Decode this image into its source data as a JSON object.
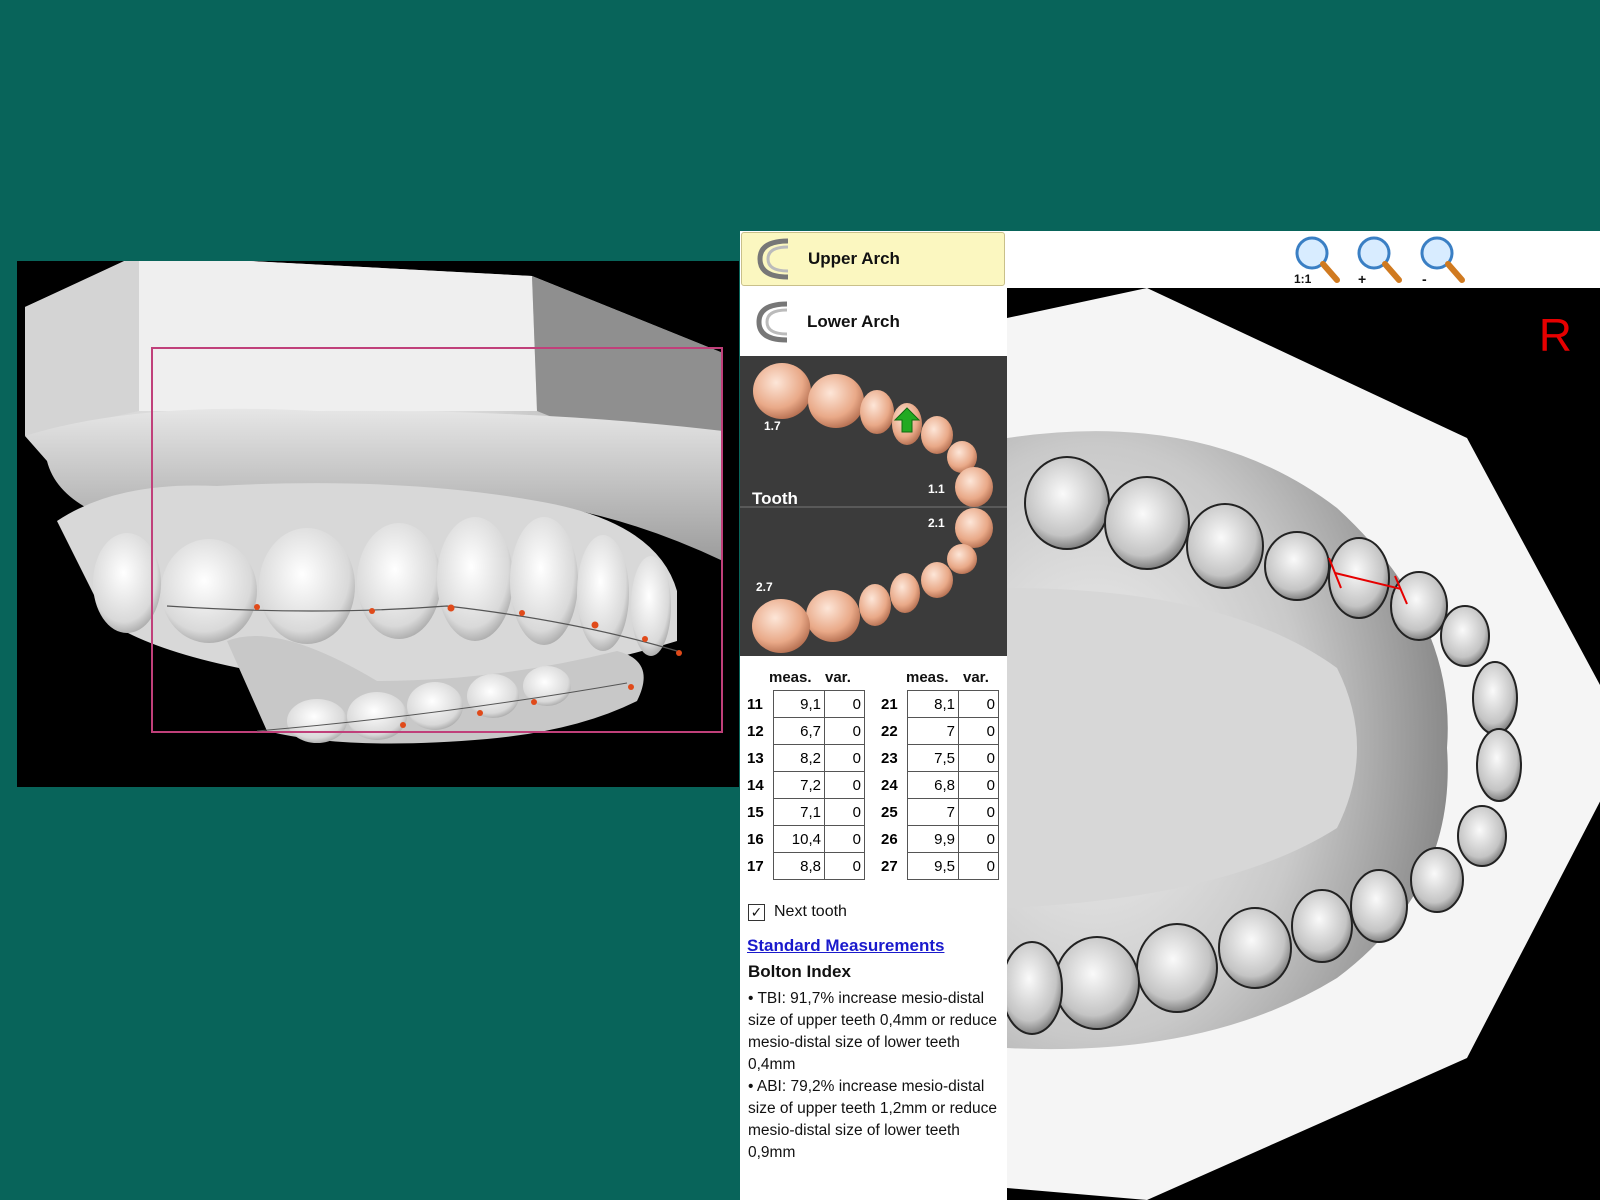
{
  "panel": {
    "upper_arch_label": "Upper Arch",
    "lower_arch_label": "Lower Arch",
    "selected_arch": "upper",
    "tooth_map": {
      "title": "Tooth",
      "labels": [
        "1.7",
        "1.1",
        "2.1",
        "2.7"
      ]
    },
    "table_headers": {
      "meas": "meas.",
      "var": "var."
    },
    "upper_quadrant": [
      {
        "tooth": "11",
        "meas": "9,1",
        "var": "0"
      },
      {
        "tooth": "12",
        "meas": "6,7",
        "var": "0"
      },
      {
        "tooth": "13",
        "meas": "8,2",
        "var": "0"
      },
      {
        "tooth": "14",
        "meas": "7,2",
        "var": "0"
      },
      {
        "tooth": "15",
        "meas": "7,1",
        "var": "0"
      },
      {
        "tooth": "16",
        "meas": "10,4",
        "var": "0"
      },
      {
        "tooth": "17",
        "meas": "8,8",
        "var": "0"
      }
    ],
    "left_quadrant": [
      {
        "tooth": "21",
        "meas": "8,1",
        "var": "0"
      },
      {
        "tooth": "22",
        "meas": "7",
        "var": "0"
      },
      {
        "tooth": "23",
        "meas": "7,5",
        "var": "0"
      },
      {
        "tooth": "24",
        "meas": "6,8",
        "var": "0"
      },
      {
        "tooth": "25",
        "meas": "7",
        "var": "0"
      },
      {
        "tooth": "26",
        "meas": "9,9",
        "var": "0"
      },
      {
        "tooth": "27",
        "meas": "9,5",
        "var": "0"
      }
    ],
    "next_tooth": {
      "label": "Next tooth",
      "checked": true
    },
    "standard_measurements_link": "Standard Measurements",
    "bolton": {
      "title": "Bolton Index",
      "tbi": "• TBI: 91,7% increase mesio-distal size of upper teeth 0,4mm or reduce mesio-distal size of lower teeth 0,4mm",
      "abi": "• ABI: 79,2% increase mesio-distal size of upper teeth 1,2mm or reduce mesio-distal size of lower teeth 0,9mm"
    }
  },
  "toolbar": {
    "zoom_buttons": [
      {
        "icon": "zoom-1to1-icon",
        "label": "1:1"
      },
      {
        "icon": "zoom-in-icon",
        "label": "+"
      },
      {
        "icon": "zoom-out-icon",
        "label": "-"
      }
    ]
  },
  "occlusal_view": {
    "side_marker": "R"
  },
  "colors": {
    "background": "#08645a",
    "active_arch": "#fbf7c0",
    "link": "#1a1acc",
    "marker": "#e60000",
    "selected_tooth_arrow": "#22aa22"
  }
}
